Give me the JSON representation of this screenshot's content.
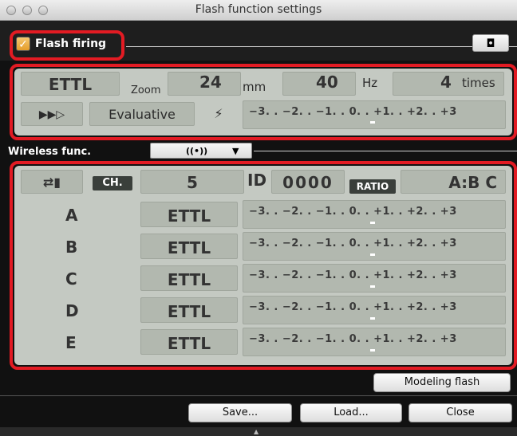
{
  "window": {
    "title": "Flash function settings"
  },
  "flash_firing": {
    "checked": true,
    "check_glyph": "✓",
    "label": "Flash firing"
  },
  "toolbar": {
    "camera_icon": "◘"
  },
  "flash_panel": {
    "mode": "ETTL",
    "zoom_label": "Zoom",
    "zoom_value": "24",
    "zoom_unit": "mm",
    "freq_value": "40",
    "freq_unit": "Hz",
    "times_value": "4",
    "times_unit": "times",
    "sync_icon": "▶▶▷",
    "metering": "Evaluative",
    "fec_icon": "⚡",
    "scale": "−3. . −2. . −1. . 0. . +1. . +2. . +3"
  },
  "wireless": {
    "label": "Wireless func.",
    "dropdown_icon": "((•))",
    "dropdown_arrow": "▼"
  },
  "wireless_panel": {
    "ch_label": "CH.",
    "channel": "5",
    "id_label": "ID",
    "id_value": "0000",
    "ratio_label": "RATIO",
    "ratio_value": "A:B C",
    "groups": [
      {
        "name": "A",
        "mode": "ETTL",
        "scale": "−3. . −2. . −1. . 0. . +1. . +2. . +3"
      },
      {
        "name": "B",
        "mode": "ETTL",
        "scale": "−3. . −2. . −1. . 0. . +1. . +2. . +3"
      },
      {
        "name": "C",
        "mode": "ETTL",
        "scale": "−3. . −2. . −1. . 0. . +1. . +2. . +3"
      },
      {
        "name": "D",
        "mode": "ETTL",
        "scale": "−3. . −2. . −1. . 0. . +1. . +2. . +3"
      },
      {
        "name": "E",
        "mode": "ETTL",
        "scale": "−3. . −2. . −1. . 0. . +1. . +2. . +3"
      }
    ]
  },
  "buttons": {
    "modeling_flash": "Modeling flash",
    "save": "Save...",
    "load": "Load...",
    "close": "Close"
  },
  "colors": {
    "highlight": "#e21b23",
    "lcd": "#c4c9c2",
    "checkbox": "#e8a73a"
  }
}
